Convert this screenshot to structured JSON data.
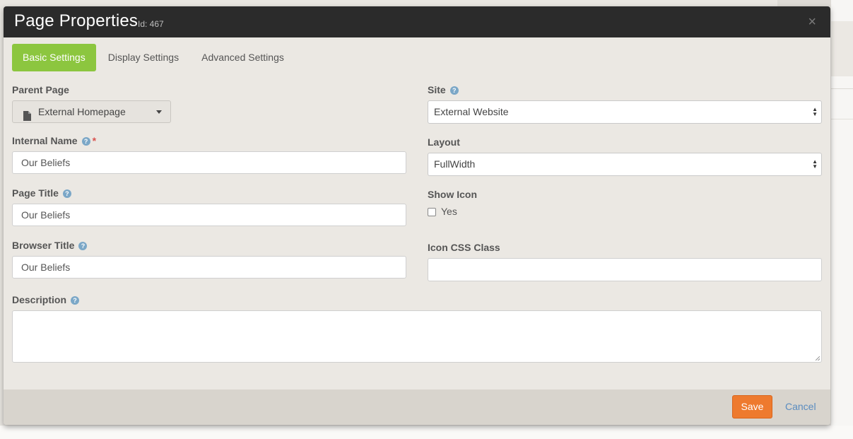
{
  "modal": {
    "title": "Page Properties",
    "id_text": "Id: 467",
    "close_glyph": "×"
  },
  "tabs": [
    {
      "label": "Basic Settings",
      "active": true
    },
    {
      "label": "Display Settings",
      "active": false
    },
    {
      "label": "Advanced Settings",
      "active": false
    }
  ],
  "fields": {
    "parent_page": {
      "label": "Parent Page",
      "value": "External Homepage"
    },
    "internal_name": {
      "label": "Internal Name",
      "value": "Our Beliefs",
      "required_mark": "*"
    },
    "page_title": {
      "label": "Page Title",
      "value": "Our Beliefs"
    },
    "browser_title": {
      "label": "Browser Title",
      "value": "Our Beliefs"
    },
    "description": {
      "label": "Description",
      "value": ""
    },
    "site": {
      "label": "Site",
      "value": "External Website"
    },
    "layout": {
      "label": "Layout",
      "value": "FullWidth"
    },
    "show_icon": {
      "label": "Show Icon",
      "option": "Yes",
      "checked": false
    },
    "icon_css_class": {
      "label": "Icon CSS Class",
      "value": ""
    }
  },
  "footer": {
    "save_label": "Save",
    "cancel_label": "Cancel"
  },
  "colors": {
    "active_tab": "#8cc63f",
    "save_button": "#ee7a2e",
    "header": "#2b2b2b",
    "link": "#5a8cc0",
    "help_icon": "#7ba7c7"
  },
  "icons": {
    "help": "question-circle-icon",
    "parent_page": "file-icon",
    "close": "close-icon"
  }
}
